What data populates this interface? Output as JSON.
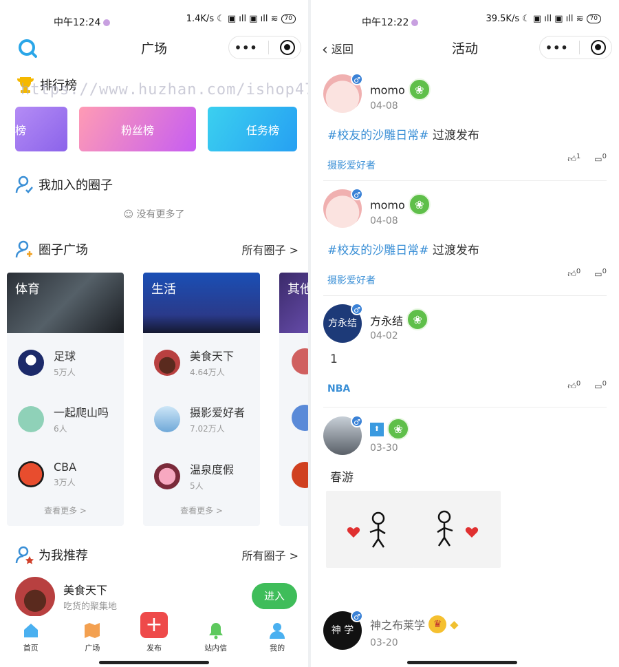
{
  "left": {
    "status": {
      "time": "中午12:24",
      "net": "1.4K/s",
      "battery": "70"
    },
    "nav": {
      "title": "广场"
    },
    "watermark": "https://www.huzhan.com/ishop47855",
    "ranking": {
      "title": "排行榜",
      "cards": [
        "榜",
        "粉丝榜",
        "任务榜"
      ]
    },
    "joined": {
      "title": "我加入的圈子",
      "empty": "☺ 没有更多了"
    },
    "square": {
      "title": "圈子广场",
      "more": "所有圈子 >",
      "cards": [
        {
          "banner": "体育",
          "items": [
            {
              "name": "足球",
              "count": "5万人"
            },
            {
              "name": "一起爬山吗",
              "count": "6人"
            },
            {
              "name": "CBA",
              "count": "3万人"
            }
          ],
          "more": "查看更多 >"
        },
        {
          "banner": "生活",
          "items": [
            {
              "name": "美食天下",
              "count": "4.64万人"
            },
            {
              "name": "摄影爱好者",
              "count": "7.02万人"
            },
            {
              "name": "温泉度假",
              "count": "5人"
            }
          ],
          "more": "查看更多 >"
        },
        {
          "banner": "其他"
        }
      ]
    },
    "recommend": {
      "title": "为我推荐",
      "more": "所有圈子 >",
      "item_name": "美食天下",
      "item_desc": "吃货的聚集地",
      "enter": "进入"
    },
    "tabs": [
      "首页",
      "广场",
      "发布",
      "站内信",
      "我的"
    ]
  },
  "right": {
    "status": {
      "time": "中午12:22",
      "net": "39.5K/s",
      "battery": "70"
    },
    "nav": {
      "back": "返回",
      "title": "活动"
    },
    "posts": [
      {
        "name": "momo",
        "date": "04-08",
        "topic": "#校友的沙雕日常#",
        "text": " 过渡发布",
        "tag": "摄影爱好者",
        "likes": "1",
        "comments": "0"
      },
      {
        "name": "momo",
        "date": "04-08",
        "topic": "#校友的沙雕日常#",
        "text": " 过渡发布",
        "tag": "摄影爱好者",
        "likes": "0",
        "comments": "0"
      },
      {
        "name": "方永结",
        "date": "04-02",
        "topic": "",
        "text": "1",
        "tag": "NBA",
        "likes": "0",
        "comments": "0"
      },
      {
        "name": "",
        "date": "03-30",
        "topic": "",
        "text": "春游",
        "tag": "",
        "likes": "",
        "comments": ""
      },
      {
        "name": "神之布莱学",
        "date": "03-20"
      }
    ],
    "avatar_text": "方永结",
    "avatar_text2": "神 学"
  }
}
